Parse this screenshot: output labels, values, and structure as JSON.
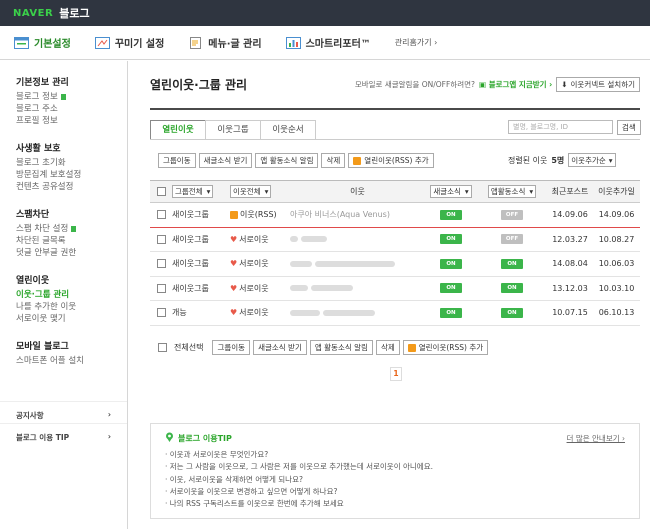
{
  "topbar": {
    "logo": "NAVER",
    "title": "블로그"
  },
  "menu": {
    "items": [
      {
        "label": "기본설정",
        "active": true
      },
      {
        "label": "꾸미기 설정"
      },
      {
        "label": "메뉴·글 관리"
      },
      {
        "label": "스마트리포터™"
      }
    ],
    "extra": "관리홈가기 ›"
  },
  "sidebar": {
    "groups": [
      {
        "head": "기본정보 관리",
        "items": [
          "블로그 정보",
          "블로그 주소",
          "프로필 정보"
        ]
      },
      {
        "head": "사생활 보호",
        "items": [
          "블로그 초기화",
          "방문집계 보호설정",
          "컨텐츠 공유설정"
        ]
      },
      {
        "head": "스팸차단",
        "items": [
          "스팸 차단 설정",
          "차단된 글목록",
          "덧글 안부글 권한"
        ]
      },
      {
        "head": "열린이웃",
        "items": [
          "이웃·그룹 관리",
          "나를 추가한 이웃",
          "서로이웃 맺기"
        ]
      },
      {
        "head": "모바일 블로그",
        "items": [
          "스마트폰 어플 설치"
        ]
      }
    ],
    "footer": [
      {
        "label": "공지사항",
        "arrow": "›"
      },
      {
        "label": "블로그 이용 TIP",
        "arrow": "›"
      }
    ]
  },
  "main": {
    "title": "열린이웃·그룹 관리",
    "mobile_text": "모바일로 새글알림을 ON/OFF하려면?",
    "app_link": "블로그앱 지금받기 ›",
    "install_btn": "이웃커넥트 설치하기",
    "tabs": [
      "열린이웃",
      "이웃그룹",
      "이웃순서"
    ],
    "search_placeholder": "별명, 블로그명, ID",
    "search_btn": "검색",
    "actions": [
      "그룹이동",
      "새글소식 받기",
      "앱 활동소식 알림",
      "삭제",
      "열린이웃(RSS) 추가"
    ],
    "sort_label": "정렬된 이웃",
    "sort_count": "5명",
    "sort_select": "이웃추가순",
    "columns": {
      "group": "그룹전체",
      "type": "이웃전체",
      "nick": "이웃",
      "sub": "새글소식",
      "app": "앱활동소식",
      "recent": "최근포스트",
      "added": "이웃추가일"
    },
    "rows": [
      {
        "group": "새이웃그룹",
        "type": "이웃(RSS)",
        "rss": true,
        "nick": "아쿠아 비너스(Aqua Venus)",
        "sub": "ON",
        "app": "OFF",
        "recent": "14.09.06",
        "added": "14.09.06",
        "highlight": true
      },
      {
        "group": "새이웃그룹",
        "type": "서로이웃",
        "nick": "",
        "sub": "ON",
        "app": "OFF",
        "recent": "12.03.27",
        "added": "10.08.27"
      },
      {
        "group": "새이웃그룹",
        "type": "서로이웃",
        "nick": "",
        "sub": "ON",
        "app": "ON",
        "recent": "14.08.04",
        "added": "10.06.03"
      },
      {
        "group": "새이웃그룹",
        "type": "서로이웃",
        "nick": "",
        "sub": "ON",
        "app": "ON",
        "recent": "13.12.03",
        "added": "10.03.10"
      },
      {
        "group": "개능",
        "type": "서로이웃",
        "nick": "",
        "sub": "ON",
        "app": "ON",
        "recent": "10.07.15",
        "added": "06.10.13"
      }
    ],
    "select_all": "전체선택",
    "page": "1",
    "tip": {
      "title": "블로그 이용TIP",
      "more": "더 많은 안내보기 ›",
      "items": [
        "· 이웃과 서로이웃은 무엇인가요?",
        "· 저는 그 사람을 이웃으로, 그 사람은 저를 이웃으로 추가했는데 서로이웃이 아니에요.",
        "· 이웃, 서로이웃을 삭제하면 어떻게 되나요?",
        "· 서로이웃을 이웃으로 변경하고 싶으면 어떻게 하나요?",
        "· 나의 RSS 구독리스트를 이웃으로 한번에 추가해 보세요"
      ]
    }
  }
}
